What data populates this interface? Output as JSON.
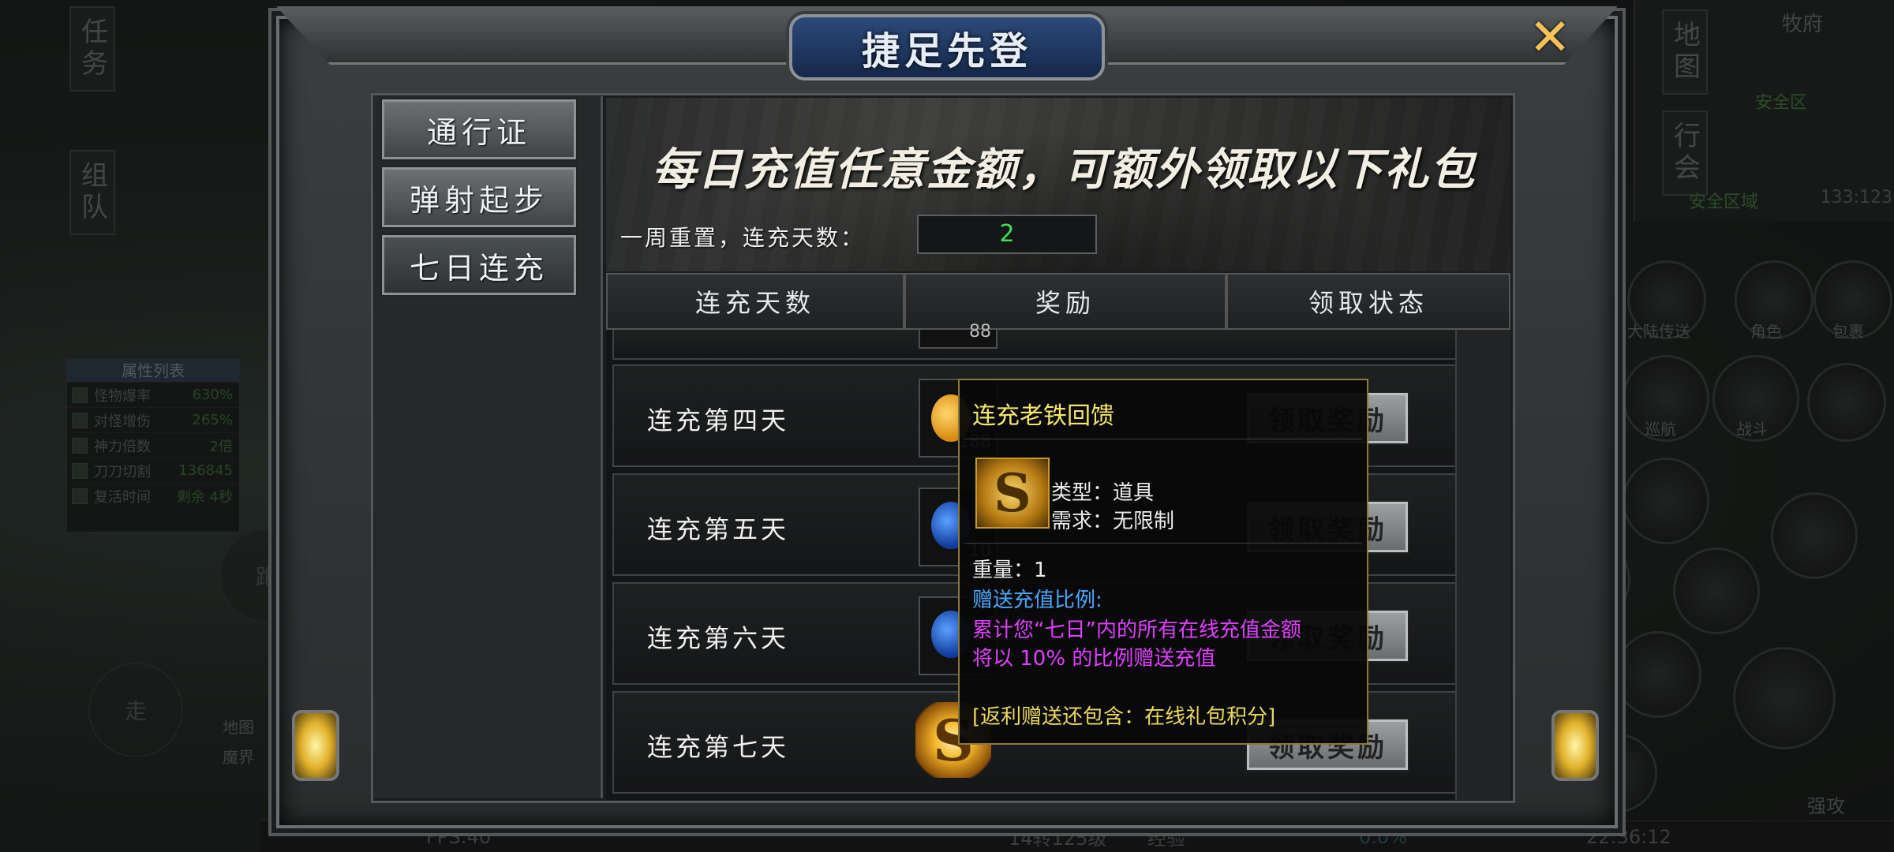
{
  "hud": {
    "task_label": "任务",
    "team_label": "组队",
    "map_label": "地图",
    "guild_label": "行会",
    "map_name": "牧府",
    "safe_zone": "安全区",
    "safe_zone_2": "安全区域",
    "coords": "133:123",
    "attr_panel_title": "属性列表",
    "attr_rows": [
      {
        "label": "怪物爆率",
        "value": "630%"
      },
      {
        "label": "对怪增伤",
        "value": "265%"
      },
      {
        "label": "神力倍数",
        "value": "2倍"
      },
      {
        "label": "刀刀切割",
        "value": "136845"
      },
      {
        "label": "复活时间",
        "value": "剩余 4秒"
      }
    ],
    "skills": [
      "大陆传送",
      "角色",
      "包裹",
      "巡航",
      "战斗"
    ],
    "joystick_run": "跑",
    "joystick_walk": "走",
    "bottom_map": "地图",
    "bottom_map_2": "魔界",
    "attack_label": "强攻",
    "fps": "FPS:40",
    "level": "14转125级",
    "exp_label": "经验",
    "exp_value": "0.0%",
    "clock": "22:36:12"
  },
  "dialog": {
    "title": "捷足先登",
    "close_icon": "close-x",
    "tabs": [
      {
        "label": "通行证",
        "active": false
      },
      {
        "label": "弹射起步",
        "active": false
      },
      {
        "label": "七日连充",
        "active": true
      }
    ],
    "banner_headline": "每日充值任意金额，可额外领取以下礼包",
    "reset_label": "一周重置，连充天数：",
    "consecutive_days": "2",
    "columns": [
      "连充天数",
      "奖励",
      "领取状态"
    ],
    "partial_row_count": "88",
    "rows": [
      {
        "day": "连充第四天",
        "item_count": "188",
        "claim": "领取奖励"
      },
      {
        "day": "连充第五天",
        "item_count": "10",
        "claim": "领取奖励"
      },
      {
        "day": "连充第六天",
        "item_count": "",
        "claim": "领取奖励"
      },
      {
        "day": "连充第七天",
        "item_count": "",
        "claim": "领取奖励"
      }
    ]
  },
  "tooltip": {
    "title": "连充老铁回馈",
    "icon_glyph": "S",
    "type_line": "类型：道具",
    "req_line": "需求：无限制",
    "weight_line": "重量：1",
    "ratio_title": "赠送充值比例:",
    "desc_1": "累计您“七日”内的所有在线充值金额",
    "desc_2": "将以 10% 的比例赠送充值",
    "note": "[返利赠送还包含：在线礼包积分]",
    "colors": {
      "title": "#f5e66b",
      "ratio": "#4aa8ff",
      "desc": "#e040ff",
      "highlight": "#4be05a",
      "note": "#e9d85c"
    }
  }
}
